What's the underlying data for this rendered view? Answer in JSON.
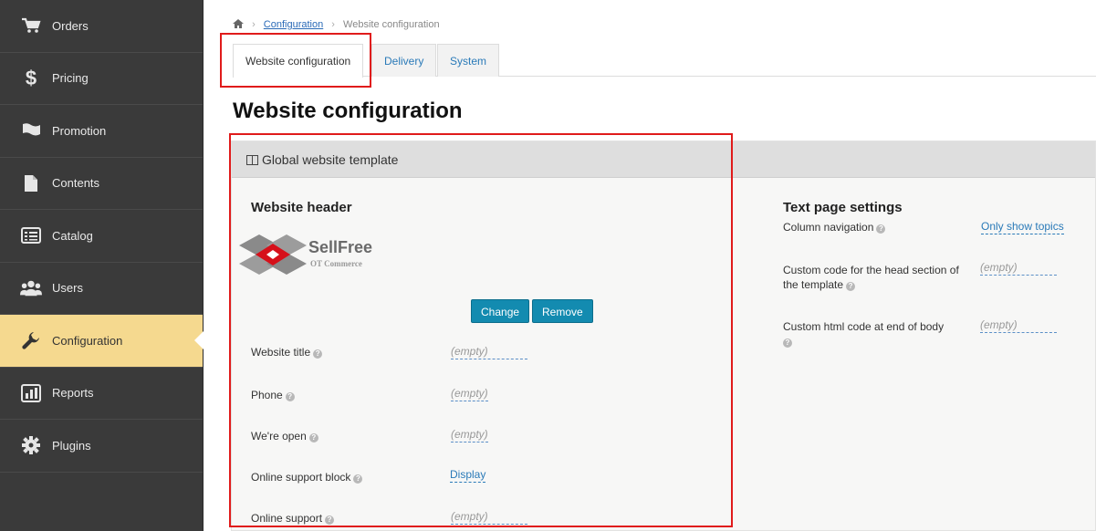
{
  "sidebar": {
    "items": [
      {
        "label": "Orders",
        "icon": "cart-icon"
      },
      {
        "label": "Pricing",
        "icon": "dollar-icon"
      },
      {
        "label": "Promotion",
        "icon": "flag-icon"
      },
      {
        "label": "Contents",
        "icon": "document-icon"
      },
      {
        "label": "Catalog",
        "icon": "list-icon"
      },
      {
        "label": "Users",
        "icon": "users-icon"
      },
      {
        "label": "Configuration",
        "icon": "wrench-icon",
        "active": true
      },
      {
        "label": "Reports",
        "icon": "bar-chart-icon"
      },
      {
        "label": "Plugins",
        "icon": "gear-icon"
      }
    ]
  },
  "breadcrumb": {
    "home_icon": "home-icon",
    "items": [
      "Configuration",
      "Website configuration"
    ]
  },
  "tabs": [
    "Website configuration",
    "Delivery",
    "System"
  ],
  "page_title": "Website configuration",
  "panel": {
    "title": "Global website template",
    "left": {
      "section_title": "Website header",
      "logo_label": "Logo",
      "logo": {
        "name": "SellFree",
        "tagline": "OT Commerce"
      },
      "buttons": {
        "change": "Change",
        "remove": "Remove"
      },
      "fields": [
        {
          "label": "Website title",
          "value": "(empty)"
        },
        {
          "label": "Phone",
          "value": "(empty)"
        },
        {
          "label": "We're open",
          "value": "(empty)"
        },
        {
          "label": "Online support block",
          "value": "Display"
        },
        {
          "label": "Online support",
          "value": "(empty)"
        }
      ]
    },
    "right": {
      "section_title": "Text page settings",
      "fields": [
        {
          "label": "Column navigation",
          "value": "Only show topics"
        },
        {
          "label": "Custom code for the head section of the template",
          "value": "(empty)"
        },
        {
          "label": "Custom html code at end of body",
          "value": "(empty)"
        }
      ]
    }
  },
  "colors": {
    "sidebar_bg": "#3a3a3a",
    "active_bg": "#f5d98f",
    "accent": "#138bb0",
    "highlight": "#e01b1b"
  }
}
